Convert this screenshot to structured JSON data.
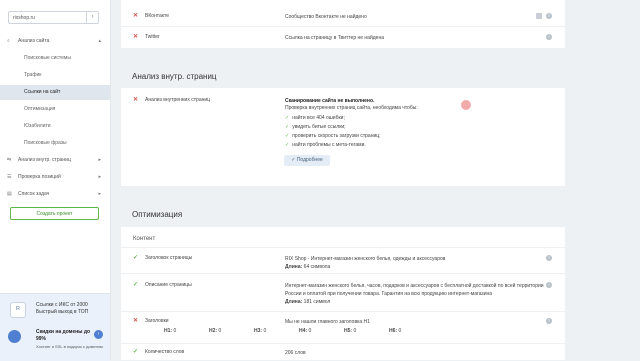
{
  "sidebar": {
    "site_select": "rixshop.ru",
    "items": [
      {
        "label": "Анализ сайта",
        "icon": "search-icon",
        "expanded": true
      },
      {
        "label": "Поисковые системы"
      },
      {
        "label": "Трафик"
      },
      {
        "label": "Ссылки на сайт",
        "active": true
      },
      {
        "label": "Оптимизация"
      },
      {
        "label": "Юзабилити"
      },
      {
        "label": "Поисковые фразы"
      },
      {
        "label": "Анализ внутр. страниц",
        "icon": "pages-icon"
      },
      {
        "label": "Проверка позиций",
        "icon": "positions-icon"
      },
      {
        "label": "Список задач",
        "icon": "tasks-icon"
      }
    ],
    "create_project": "Создать проект",
    "promo": {
      "line1": "Ссылки с ИКС от 2000",
      "line2": "Быстрый выход в ТОП",
      "title": "Скидки на домены до 99%",
      "text": "Хостинг и SSL в подарок с доменом"
    }
  },
  "social": [
    {
      "label": "ВКонтакте",
      "status": "fail",
      "value": "Сообщество Вконтакте не найдено"
    },
    {
      "label": "Twitter",
      "status": "fail",
      "value": "Ссылка на страницу в Твиттер не найдена"
    }
  ],
  "inner": {
    "section_title": "Анализ внутр. страниц",
    "row_label": "Анализ внутренних страниц",
    "status_title": "Сканирование сайта не выполнено.",
    "intro": "Проверка внутренних страниц сайта, необходима чтобы:",
    "checks": [
      "найти все 404 ошибки;",
      "увидеть битые ссылки;",
      "проверить скорость загрузки страниц;",
      "найти проблемы с мета-тегами."
    ],
    "more_button": "Подробнее"
  },
  "optimization": {
    "section_title": "Оптимизация",
    "subsection": "Контент",
    "rows": [
      {
        "label": "Заголовок страницы",
        "status": "ok",
        "value": "RIX Shop - Интернет-магазин женского белья, одежды и аксессуаров",
        "extra_label": "Длина:",
        "extra_value": "64 символа"
      },
      {
        "label": "Описание страницы",
        "status": "ok",
        "value": "Интернет-магазин женского белья, часов, подарков и аксессуаров с бесплатной доставкой по всей территории России и оплатой при получении товара. Гарантия на всю продукцию интернет-магазина",
        "extra_label": "Длина:",
        "extra_value": "181 символ"
      },
      {
        "label": "Заголовки",
        "status": "fail",
        "value": "Мы не нашли главного заголовка H1"
      },
      {
        "label": "Количество слов",
        "status": "ok",
        "value": "206 слов"
      }
    ],
    "headings": [
      {
        "tag": "H1:",
        "count": "0"
      },
      {
        "tag": "H2:",
        "count": "0"
      },
      {
        "tag": "H3:",
        "count": "0"
      },
      {
        "tag": "H4:",
        "count": "0"
      },
      {
        "tag": "H5:",
        "count": "0"
      },
      {
        "tag": "H6:",
        "count": "0"
      }
    ]
  },
  "colors": {
    "fail": "#d9534f",
    "ok": "#5fb646",
    "accent": "#4f7fd0"
  }
}
